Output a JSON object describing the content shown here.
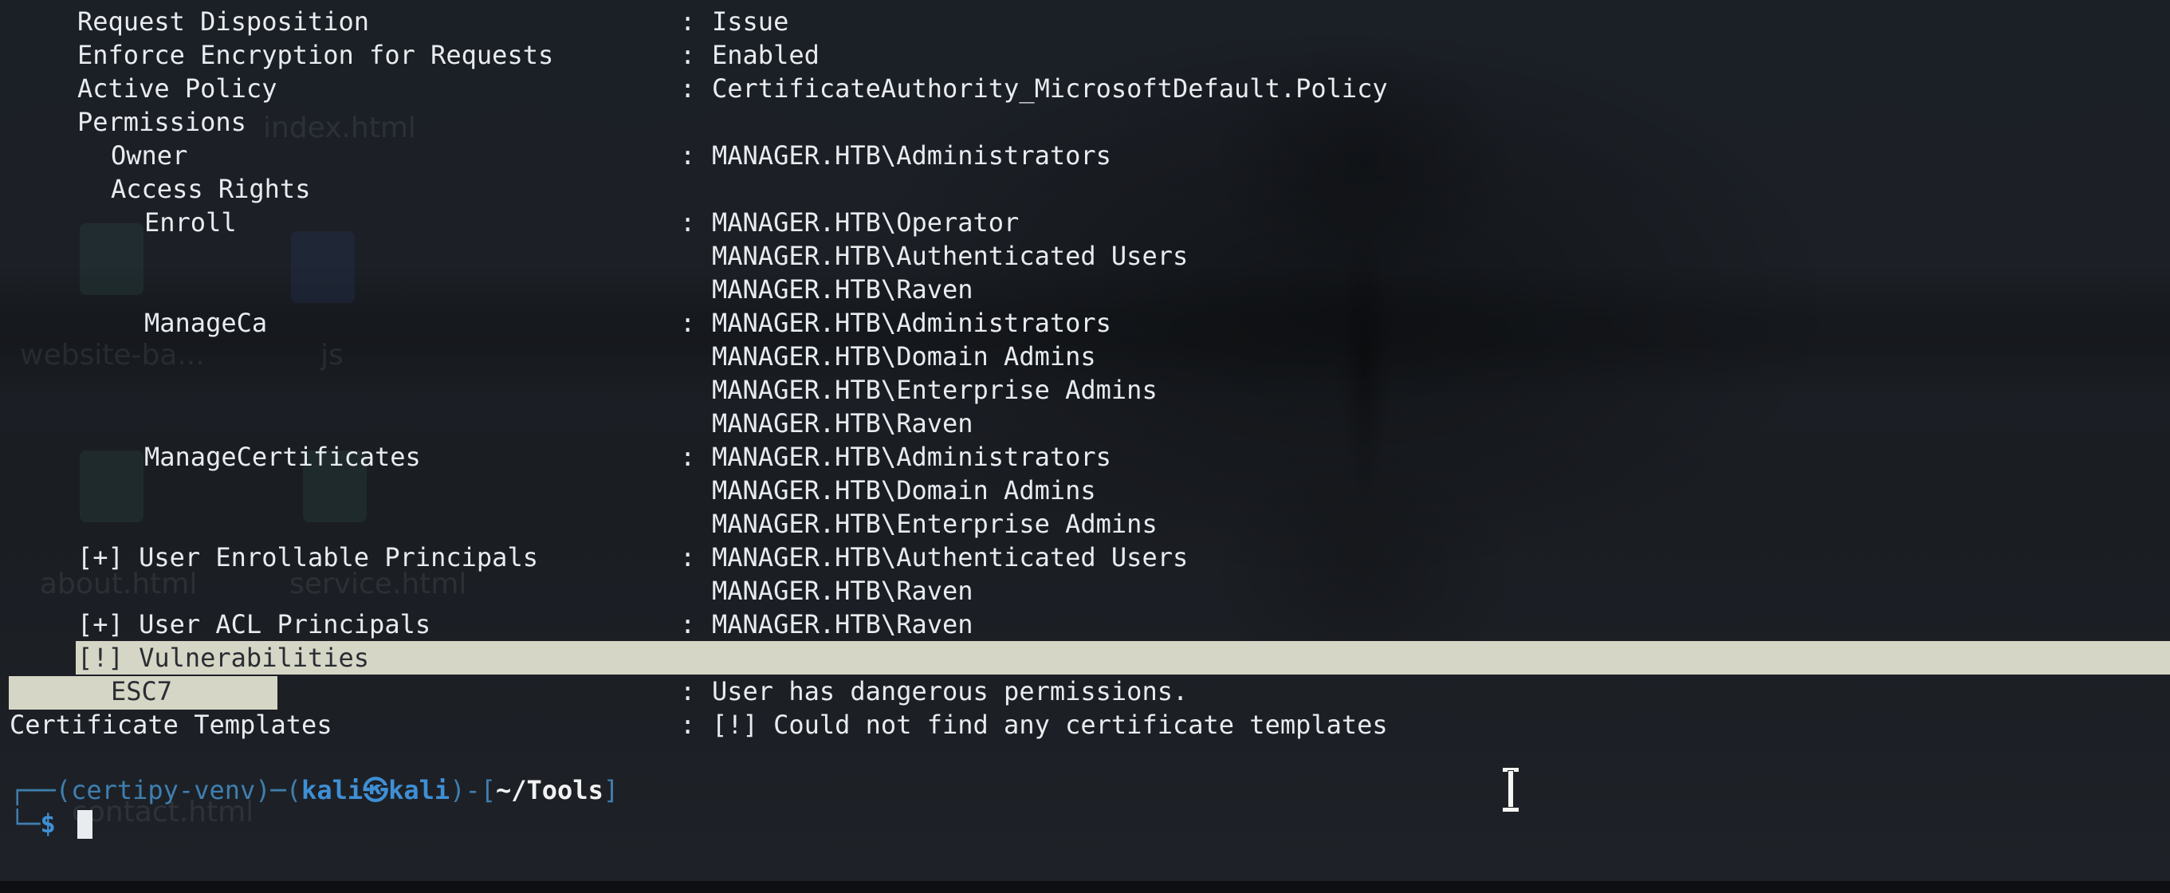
{
  "terminal": {
    "rows": [
      {
        "key": "Request Disposition",
        "indent": 1,
        "value": "Issue"
      },
      {
        "key": "Enforce Encryption for Requests",
        "indent": 1,
        "value": "Enabled"
      },
      {
        "key": "Active Policy",
        "indent": 1,
        "value": "CertificateAuthority_MicrosoftDefault.Policy"
      },
      {
        "key": "Permissions",
        "indent": 1,
        "value": ""
      },
      {
        "key": "Owner",
        "indent": 2,
        "value": "MANAGER.HTB\\Administrators"
      },
      {
        "key": "Access Rights",
        "indent": 2,
        "value": ""
      },
      {
        "key": "Enroll",
        "indent": 3,
        "value": "MANAGER.HTB\\Operator"
      },
      {
        "key": "",
        "indent": 3,
        "value": "MANAGER.HTB\\Authenticated Users"
      },
      {
        "key": "",
        "indent": 3,
        "value": "MANAGER.HTB\\Raven"
      },
      {
        "key": "ManageCa",
        "indent": 3,
        "value": "MANAGER.HTB\\Administrators"
      },
      {
        "key": "",
        "indent": 3,
        "value": "MANAGER.HTB\\Domain Admins"
      },
      {
        "key": "",
        "indent": 3,
        "value": "MANAGER.HTB\\Enterprise Admins"
      },
      {
        "key": "",
        "indent": 3,
        "value": "MANAGER.HTB\\Raven"
      },
      {
        "key": "ManageCertificates",
        "indent": 3,
        "value": "MANAGER.HTB\\Administrators"
      },
      {
        "key": "",
        "indent": 3,
        "value": "MANAGER.HTB\\Domain Admins"
      },
      {
        "key": "",
        "indent": 3,
        "value": "MANAGER.HTB\\Enterprise Admins"
      },
      {
        "key": "[+] User Enrollable Principals",
        "indent": 1,
        "value": "MANAGER.HTB\\Authenticated Users"
      },
      {
        "key": "",
        "indent": 1,
        "value": "MANAGER.HTB\\Raven"
      },
      {
        "key": "[+] User ACL Principals",
        "indent": 1,
        "value": "MANAGER.HTB\\Raven"
      },
      {
        "key": "[!] Vulnerabilities",
        "indent": 1,
        "value": ""
      },
      {
        "key": "ESC7",
        "indent": 2,
        "value": "User has dangerous permissions."
      },
      {
        "key": "Certificate Templates",
        "indent": 0,
        "value": "[!] Could not find any certificate templates"
      }
    ],
    "separator": ":",
    "prompt": {
      "top_left": "┌──",
      "bottom_left": "└─",
      "venv": "(certipy-venv)",
      "dash": "─",
      "user": "kali",
      "at_symbol": "㉿",
      "host": "kali",
      "path": "~/Tools",
      "dollar": "$"
    }
  },
  "wallpaper_ghost_labels": [
    "index.html",
    "website-ba...",
    "js",
    "about.html",
    "service.html",
    "contact.html"
  ],
  "colors": {
    "background": "#1b1f26",
    "text": "#e9ecef",
    "highlight": "#d5d6c5",
    "prompt_blue": "#3f8fd4"
  }
}
